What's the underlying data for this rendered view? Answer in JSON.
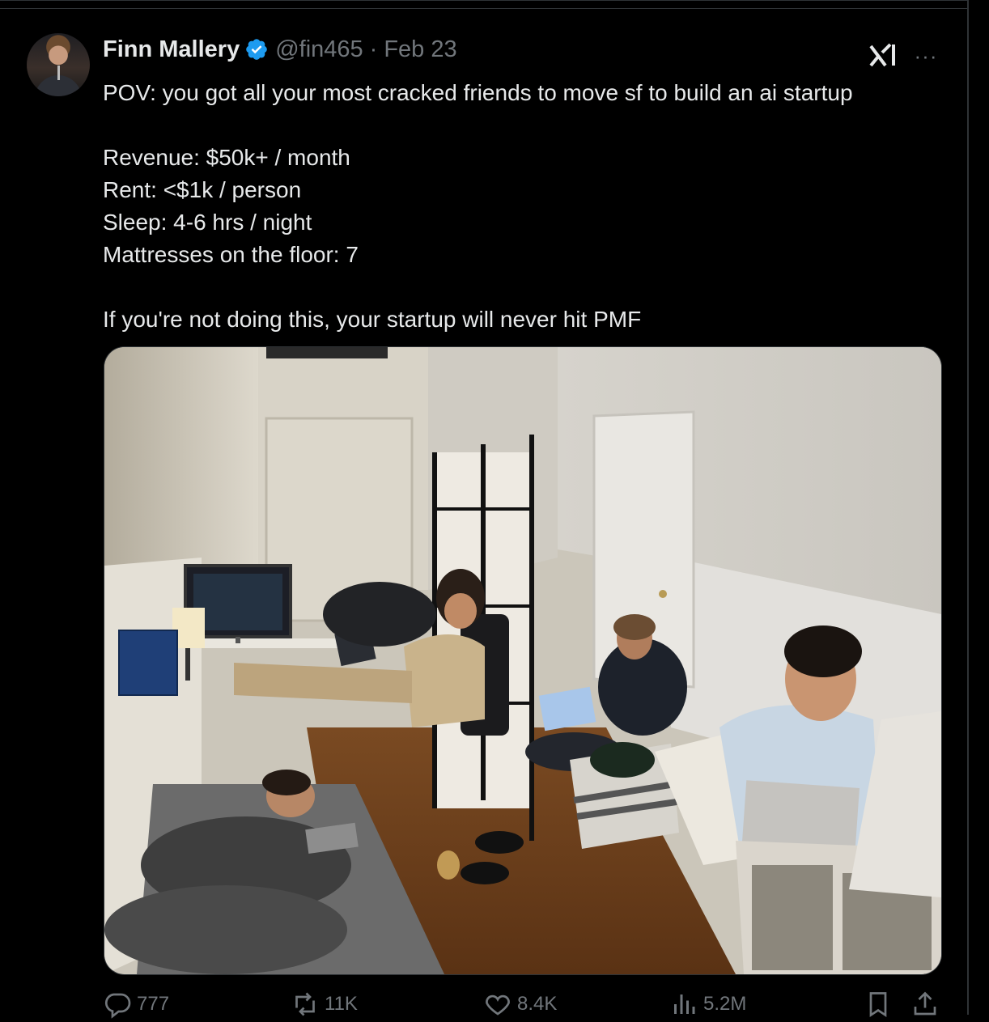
{
  "author": {
    "name": "Finn Mallery",
    "handle": "@fin465",
    "separator": "·",
    "date": "Feb 23",
    "verified": true
  },
  "tweet": {
    "lines": [
      "POV: you got all your most cracked friends to move sf to build an ai startup",
      "",
      "Revenue: $50k+ / month",
      "Rent: <$1k / person",
      "Sleep: 4-6 hrs / night",
      "Mattresses on the floor: 7",
      "",
      "If you're not doing this, your startup will never hit PMF"
    ]
  },
  "actions": {
    "replies": "777",
    "reposts": "11K",
    "likes": "8.4K",
    "views": "5.2M"
  },
  "icons": {
    "grok": "grok-icon",
    "more": "more-icon",
    "reply": "reply-icon",
    "repost": "repost-icon",
    "like": "heart-icon",
    "views": "views-icon",
    "bookmark": "bookmark-icon",
    "share": "share-icon"
  },
  "colors": {
    "background": "#000000",
    "text": "#e7e9ea",
    "muted": "#71767b",
    "verified": "#1d9bf0",
    "border": "#2f3336"
  }
}
